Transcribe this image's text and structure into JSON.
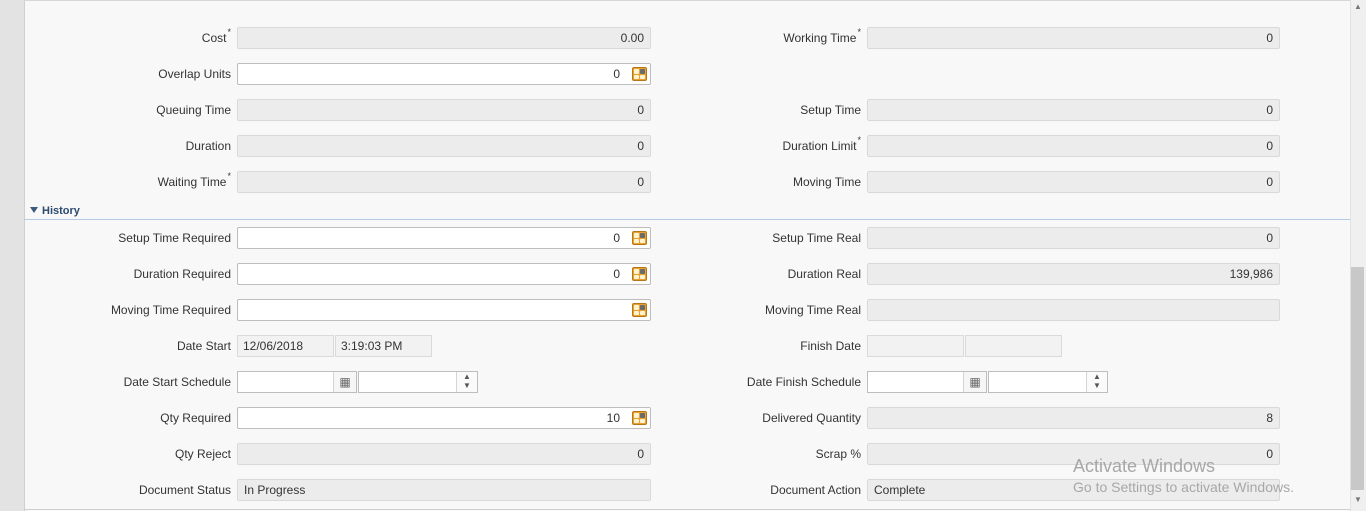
{
  "rows_top": [
    {
      "left_label": "Cost",
      "left_required": true,
      "left_value": "0.00",
      "right_label": "Working Time",
      "right_required": true,
      "right_value": "0"
    },
    {
      "left_label": "Overlap Units",
      "left_value": "0"
    },
    {
      "left_label": "Queuing Time",
      "left_value": "0",
      "right_label": "Setup Time",
      "right_value": "0"
    },
    {
      "left_label": "Duration",
      "left_value": "0",
      "right_label": "Duration Limit",
      "right_required": true,
      "right_value": "0"
    },
    {
      "left_label": "Waiting Time",
      "left_required": true,
      "left_value": "0",
      "right_label": "Moving Time",
      "right_value": "0"
    }
  ],
  "history": {
    "title": "History",
    "setup_time_required": {
      "label": "Setup Time Required",
      "value": "0"
    },
    "setup_time_real": {
      "label": "Setup Time Real",
      "value": "0"
    },
    "duration_required": {
      "label": "Duration Required",
      "value": "0"
    },
    "duration_real": {
      "label": "Duration Real",
      "value": "139,986"
    },
    "moving_time_required": {
      "label": "Moving Time Required",
      "value": ""
    },
    "moving_time_real": {
      "label": "Moving Time Real",
      "value": ""
    },
    "date_start": {
      "label": "Date Start",
      "date": "12/06/2018",
      "time": "3:19:03 PM"
    },
    "finish_date": {
      "label": "Finish Date",
      "date": "",
      "time": ""
    },
    "date_start_schedule": {
      "label": "Date Start Schedule",
      "date": "",
      "time": ""
    },
    "date_finish_schedule": {
      "label": "Date Finish Schedule",
      "date": "",
      "time": ""
    },
    "qty_required": {
      "label": "Qty Required",
      "value": "10"
    },
    "delivered_quantity": {
      "label": "Delivered Quantity",
      "value": "8"
    },
    "qty_reject": {
      "label": "Qty Reject",
      "value": "0"
    },
    "scrap_pct": {
      "label": "Scrap %",
      "value": "0"
    },
    "document_status": {
      "label": "Document Status",
      "value": "In Progress"
    },
    "document_action": {
      "label": "Document Action",
      "value": "Complete"
    }
  },
  "required_marker": "*",
  "icons": {
    "calculator": "calculator-icon",
    "calendar": "calendar-icon",
    "spinner": "spinner-icon",
    "collapse": "collapse-triangle-icon"
  },
  "watermark": {
    "line1": "Activate Windows",
    "line2": "Go to Settings to activate Windows."
  }
}
